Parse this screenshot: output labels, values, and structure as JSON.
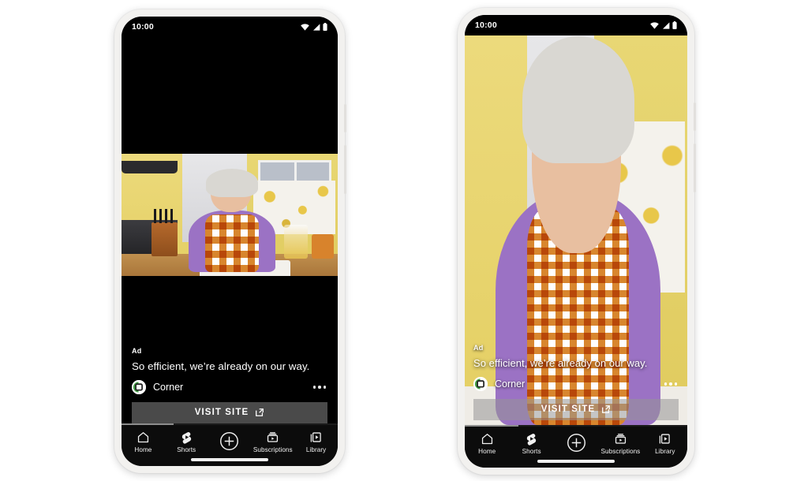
{
  "page": {
    "background": "#ffffff",
    "description": "Two Android phone mockups showing a YouTube in-feed video ad"
  },
  "status_bar": {
    "time": "10:00",
    "icons": [
      "wifi-icon",
      "cellular-signal-icon",
      "battery-icon"
    ]
  },
  "ad": {
    "label": "Ad",
    "headline": "So efficient, we’re already on our way.",
    "advertiser": "Corner",
    "avatar_icon": "corner-logo-icon",
    "cta_label": "VISIT SITE",
    "cta_icon": "external-link-icon",
    "overflow_icon": "more-options-icon",
    "cta_background": "#4a4a4a",
    "progress_percent": 24
  },
  "nav": {
    "items": [
      {
        "label": "Home",
        "icon": "home-icon"
      },
      {
        "label": "Shorts",
        "icon": "shorts-icon"
      },
      {
        "label": "",
        "icon": "create-plus-icon"
      },
      {
        "label": "Subscriptions",
        "icon": "subscriptions-icon"
      },
      {
        "label": "Library",
        "icon": "library-icon"
      }
    ]
  },
  "phones": {
    "left": {
      "name": "feed-ad-phone",
      "video_mode": "in-feed-thumbnail"
    },
    "right": {
      "name": "fullscreen-ad-phone",
      "video_mode": "full-bleed"
    }
  }
}
